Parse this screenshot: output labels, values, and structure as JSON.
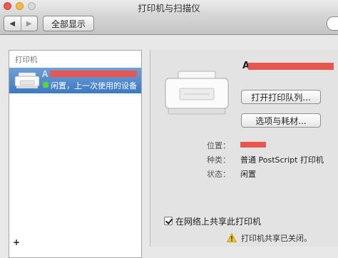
{
  "window": {
    "title": "打印机与扫描仪"
  },
  "toolbar": {
    "back": "◀",
    "forward": "▶",
    "show_all": "全部显示"
  },
  "sidebar": {
    "header": "打印机",
    "items": [
      {
        "name": "A",
        "status": "闲置，上一次使用的设备"
      }
    ],
    "add_button": "+"
  },
  "detail": {
    "printer_name": "A",
    "open_queue_button": "打开打印队列...",
    "options_button": "选项与耗材...",
    "location_label": "位置：",
    "kind_label": "种类：",
    "kind_value": "普通 PostScript 打印机",
    "status_label": "状态：",
    "status_value": "闲置",
    "share_checkbox_label": "在网络上共享此打印机",
    "share_checked": true,
    "sharing_warning": "打印机共享已关闭。"
  },
  "colors": {
    "selection": "#3d79c2",
    "redaction": "#e85650",
    "status_dot": "#5fcf45",
    "warning": "#f2c218"
  }
}
